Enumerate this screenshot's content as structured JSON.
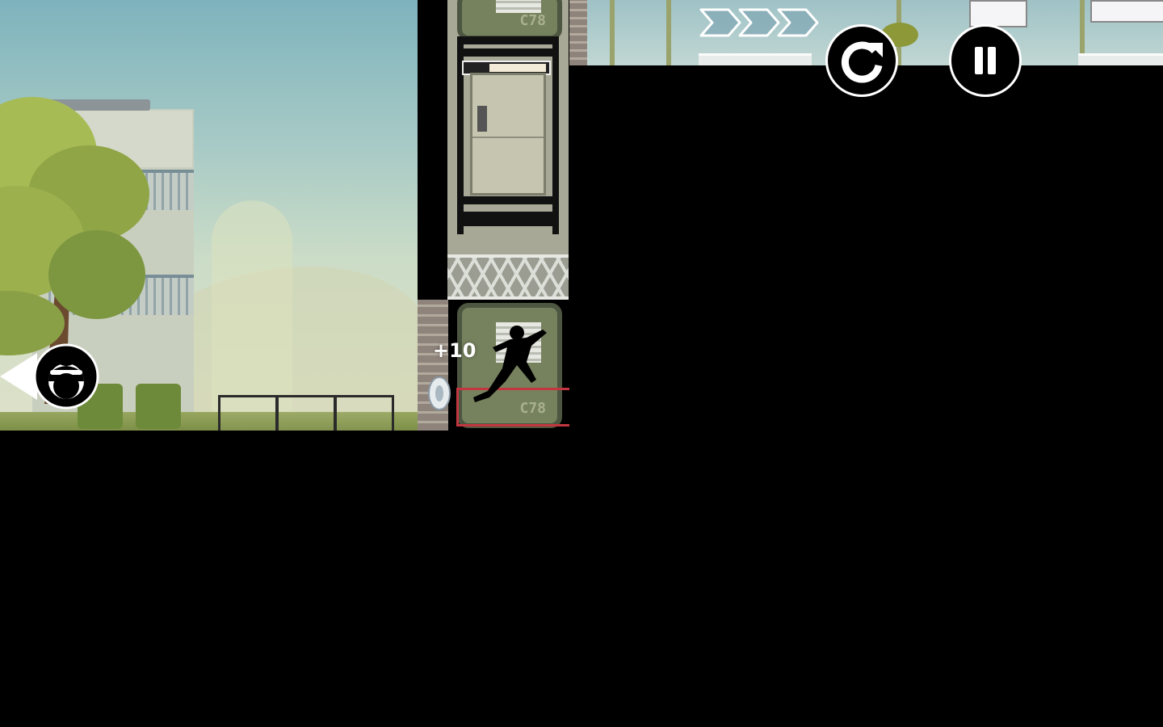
{
  "hud": {
    "restart_icon": "restart-icon",
    "pause_icon": "pause-icon",
    "back_icon": "back-arrow-icon",
    "progress_chevrons": 3
  },
  "score_popup": "+10",
  "crate_codes": [
    "C78",
    "C78"
  ],
  "colors": {
    "hud_stroke": "#ffffff",
    "hud_fill": "#000000",
    "crate": "#76825e",
    "rail": "#c2373f"
  }
}
